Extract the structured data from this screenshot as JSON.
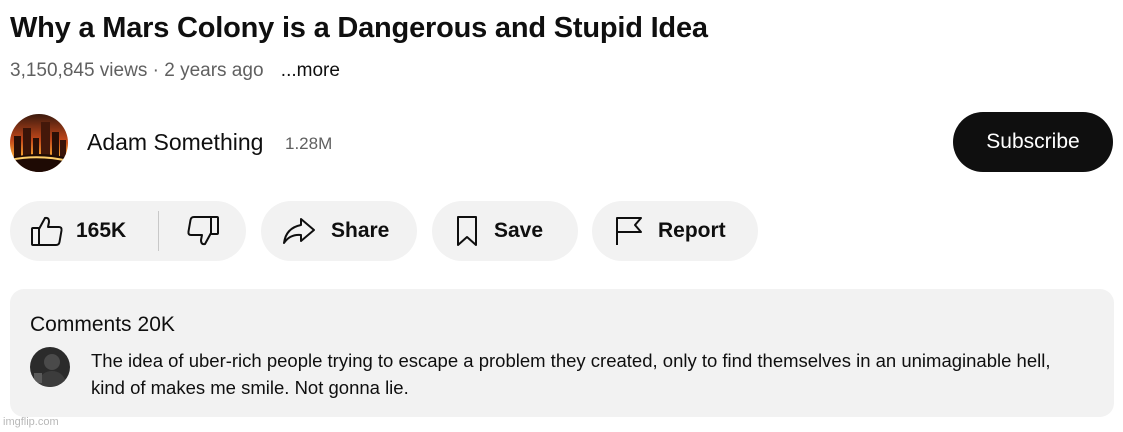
{
  "video": {
    "title": "Why a Mars Colony is a Dangerous and Stupid Idea",
    "views": "3,150,845 views",
    "separator": "·",
    "age": "2 years ago",
    "more_label": "...more"
  },
  "channel": {
    "name": "Adam Something",
    "subscribers": "1.28M",
    "avatar_icon": "city-at-sunset-avatar",
    "subscribe_label": "Subscribe"
  },
  "actions": {
    "like_count": "165K",
    "like_icon": "thumbs-up-icon",
    "dislike_icon": "thumbs-down-icon",
    "share_label": "Share",
    "share_icon": "share-arrow-icon",
    "save_label": "Save",
    "save_icon": "bookmark-icon",
    "report_label": "Report",
    "report_icon": "flag-icon"
  },
  "comments": {
    "header_label": "Comments",
    "count": "20K",
    "top_comment": {
      "avatar_icon": "dark-user-avatar",
      "text": "The idea of uber-rich people trying to escape a problem they created, only to find themselves in an unimaginable hell, kind of makes me smile. Not gonna lie."
    }
  },
  "watermark": "imgflip.com",
  "colors": {
    "subscribe_bg": "#0f0f0f",
    "pill_bg": "#f2f2f2",
    "secondary_text": "#606060"
  }
}
